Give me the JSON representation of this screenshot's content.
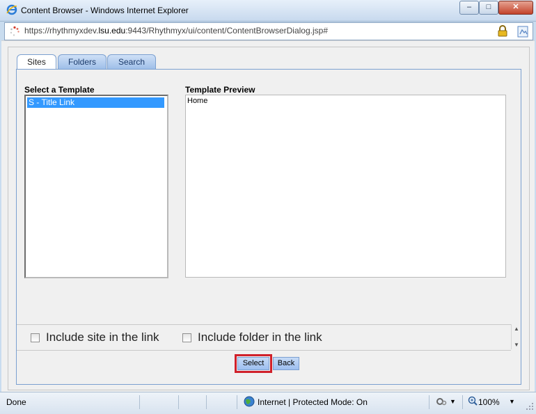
{
  "window": {
    "title": "Content Browser - Windows Internet Explorer",
    "min": "–",
    "max": "□",
    "close": "✕"
  },
  "address": {
    "url_prefix": "https://rhythmyxdev.",
    "url_host": "lsu.edu",
    "url_suffix": ":9443/Rhythmyx/ui/content/ContentBrowserDialog.jsp#"
  },
  "tabs": [
    {
      "label": "Sites",
      "active": true
    },
    {
      "label": "Folders",
      "active": false
    },
    {
      "label": "Search",
      "active": false
    }
  ],
  "template_section": {
    "label": "Select a Template",
    "items": [
      "S - Title Link"
    ],
    "selected": "S - Title Link"
  },
  "preview_section": {
    "label": "Template Preview",
    "content": "Home"
  },
  "options": {
    "include_site": "Include site in the link",
    "include_folder": "Include folder in the link",
    "scroll_up": "▲",
    "scroll_down": "▼"
  },
  "buttons": {
    "select": "Select",
    "back": "Back"
  },
  "statusbar": {
    "status": "Done",
    "zone": "Internet | Protected Mode: On",
    "zoom": "100%",
    "dropdown": "▼"
  },
  "colors": {
    "tab_border": "#7ba0d0",
    "selection": "#3399ff",
    "highlight": "#d0202a"
  }
}
